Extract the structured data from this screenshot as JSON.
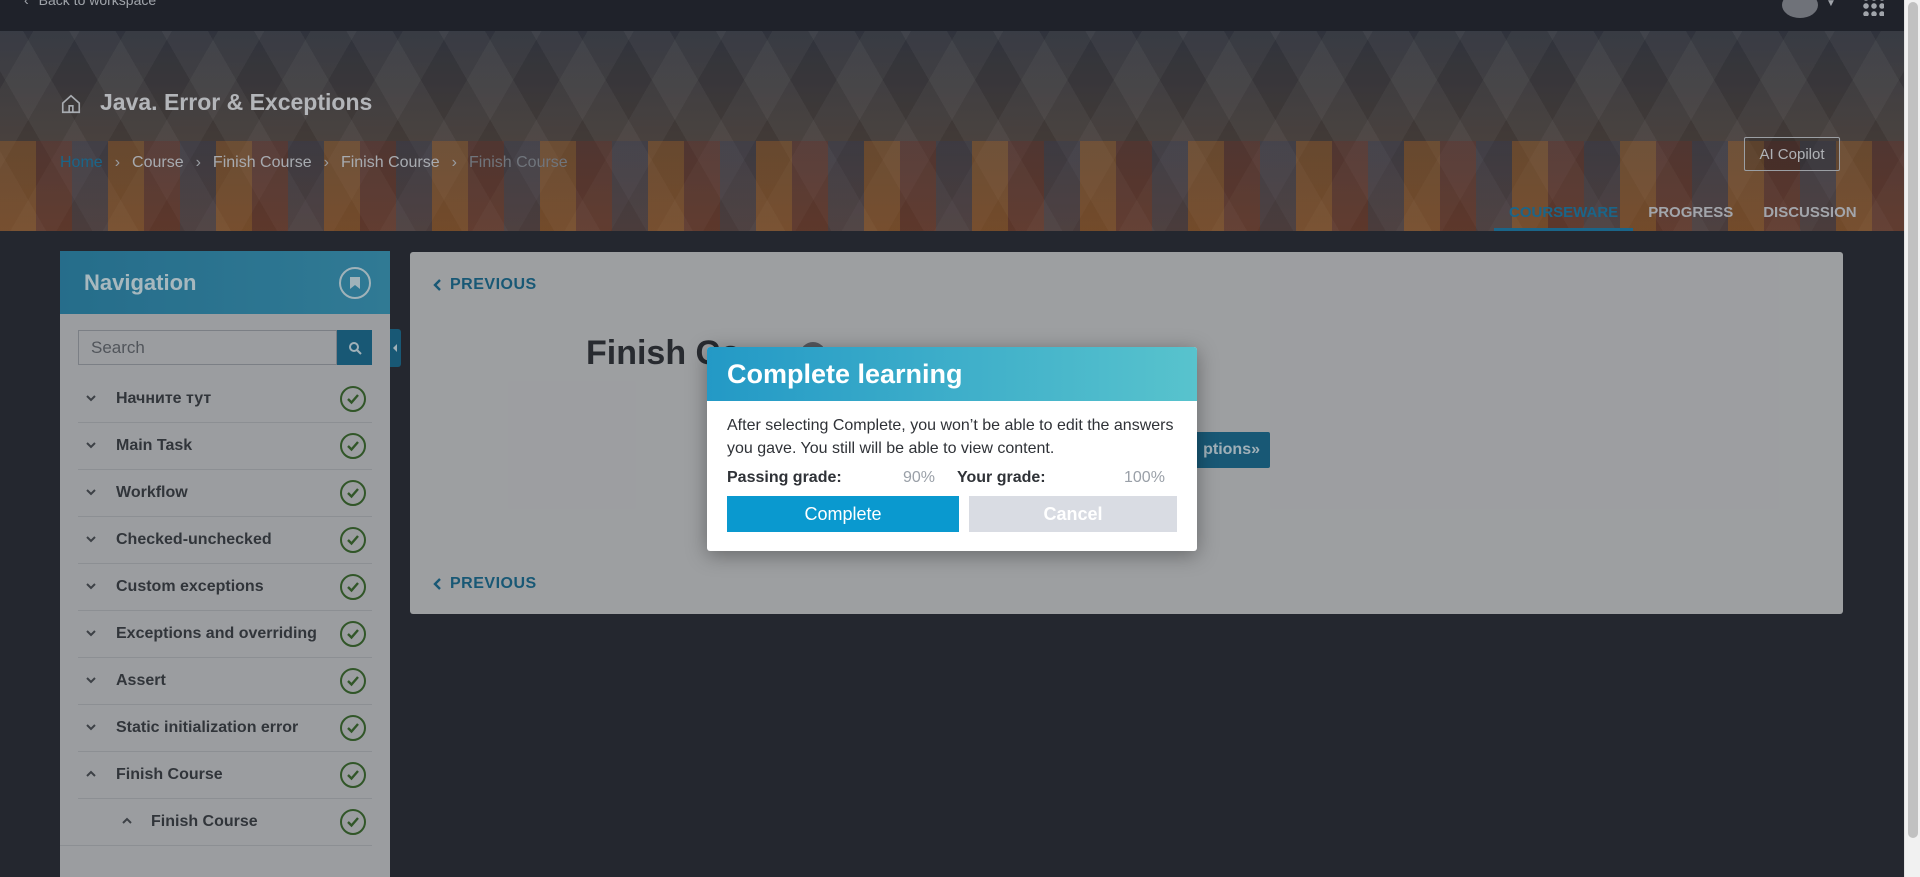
{
  "topbar": {
    "back_label": "Back to workspace"
  },
  "course": {
    "title": "Java. Error & Exceptions"
  },
  "breadcrumb": [
    "Home",
    "Course",
    "Finish Course",
    "Finish Course",
    "Finish Course"
  ],
  "ai_copilot_label": "AI Copilot",
  "tabs": [
    {
      "label": "COURSEWARE",
      "active": true
    },
    {
      "label": "PROGRESS",
      "active": false
    },
    {
      "label": "DISCUSSION",
      "active": false
    }
  ],
  "sidebar": {
    "title": "Navigation",
    "search_placeholder": "Search",
    "items": [
      {
        "label": "Начните тут",
        "expanded": false
      },
      {
        "label": "Main Task",
        "expanded": false
      },
      {
        "label": "Workflow",
        "expanded": false
      },
      {
        "label": "Checked-unchecked",
        "expanded": false
      },
      {
        "label": "Custom exceptions",
        "expanded": false
      },
      {
        "label": "Exceptions and overriding",
        "expanded": false
      },
      {
        "label": "Assert",
        "expanded": false
      },
      {
        "label": "Static initialization error",
        "expanded": false
      },
      {
        "label": "Finish Course",
        "expanded": true
      },
      {
        "label": "Finish Course",
        "expanded": true,
        "sub": true
      }
    ]
  },
  "content": {
    "previous_label": "PREVIOUS",
    "unit_title": "Finish Co",
    "next_button_label": "ptions»"
  },
  "modal": {
    "title": "Complete learning",
    "message": "After selecting Complete, you won’t be able to edit the answers you gave. You still will be able to view content.",
    "passing_grade_label": "Passing grade:",
    "passing_grade_value": "90%",
    "your_grade_label": "Your grade:",
    "your_grade_value": "100%",
    "complete_label": "Complete",
    "cancel_label": "Cancel"
  },
  "colors": {
    "accent": "#1a6e93",
    "complete_button": "#0a99cf",
    "check": "#3b6b2d"
  }
}
